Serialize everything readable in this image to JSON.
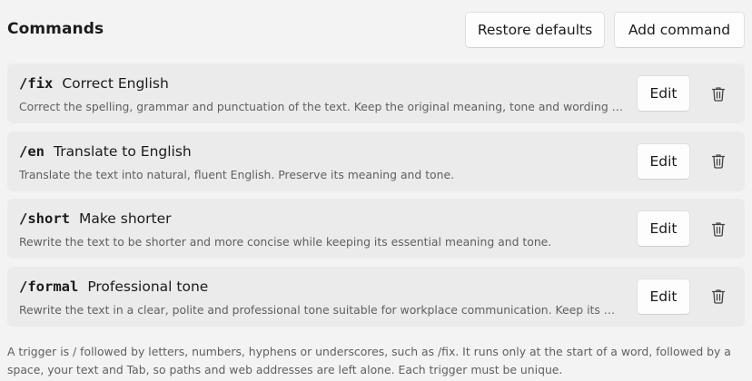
{
  "header": {
    "title": "Commands",
    "restore_label": "Restore defaults",
    "add_label": "Add command"
  },
  "commands": [
    {
      "trigger": "/fix",
      "name": "Correct English",
      "description": "Correct the spelling, grammar and punctuation of the text. Keep the original meaning, tone and wording as much as possible.",
      "edit_label": "Edit",
      "delete_icon": "trash-icon"
    },
    {
      "trigger": "/en",
      "name": "Translate to English",
      "description": "Translate the text into natural, fluent English. Preserve its meaning and tone.",
      "edit_label": "Edit",
      "delete_icon": "trash-icon"
    },
    {
      "trigger": "/short",
      "name": "Make shorter",
      "description": "Rewrite the text to be shorter and more concise while keeping its essential meaning and tone.",
      "edit_label": "Edit",
      "delete_icon": "trash-icon"
    },
    {
      "trigger": "/formal",
      "name": "Professional tone",
      "description": "Rewrite the text in a clear, polite and professional tone suitable for workplace communication. Keep its meaning.",
      "edit_label": "Edit",
      "delete_icon": "trash-icon"
    }
  ],
  "footer": {
    "note": "A trigger is / followed by letters, numbers, hyphens or underscores, such as /fix. It runs only at the start of a word, followed by a space, your text and Tab, so paths and web addresses are left alone. Each trigger must be unique."
  },
  "colors": {
    "background": "#f3f3f3",
    "card": "#ebebeb",
    "button": "#fdfdfd",
    "text_primary": "#1b1b1b",
    "text_secondary": "#5f5f5f"
  }
}
